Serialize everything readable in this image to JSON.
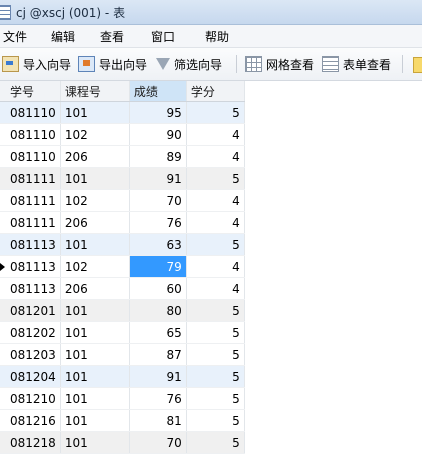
{
  "window": {
    "title": "cj @xscj (001) - 表"
  },
  "menu": [
    "文件",
    "编辑",
    "查看",
    "窗口",
    "帮助"
  ],
  "toolbar": {
    "import_label": "导入向导",
    "export_label": "导出向导",
    "filter_label": "筛选向导",
    "grid_view_label": "网格查看",
    "form_view_label": "表单查看"
  },
  "table": {
    "columns": [
      "学号",
      "课程号",
      "成绩",
      "学分"
    ],
    "sorted_column": "成绩",
    "current_row": 7,
    "current_column": "成绩",
    "rows": [
      [
        "081110",
        "101",
        "95",
        "5"
      ],
      [
        "081110",
        "102",
        "90",
        "4"
      ],
      [
        "081110",
        "206",
        "89",
        "4"
      ],
      [
        "081111",
        "101",
        "91",
        "5"
      ],
      [
        "081111",
        "102",
        "70",
        "4"
      ],
      [
        "081111",
        "206",
        "76",
        "4"
      ],
      [
        "081113",
        "101",
        "63",
        "5"
      ],
      [
        "081113",
        "102",
        "79",
        "4"
      ],
      [
        "081113",
        "206",
        "60",
        "4"
      ],
      [
        "081201",
        "101",
        "80",
        "5"
      ],
      [
        "081202",
        "101",
        "65",
        "5"
      ],
      [
        "081203",
        "101",
        "87",
        "5"
      ],
      [
        "081204",
        "101",
        "91",
        "5"
      ],
      [
        "081210",
        "101",
        "76",
        "5"
      ],
      [
        "081216",
        "101",
        "81",
        "5"
      ],
      [
        "081218",
        "101",
        "70",
        "5"
      ]
    ]
  }
}
